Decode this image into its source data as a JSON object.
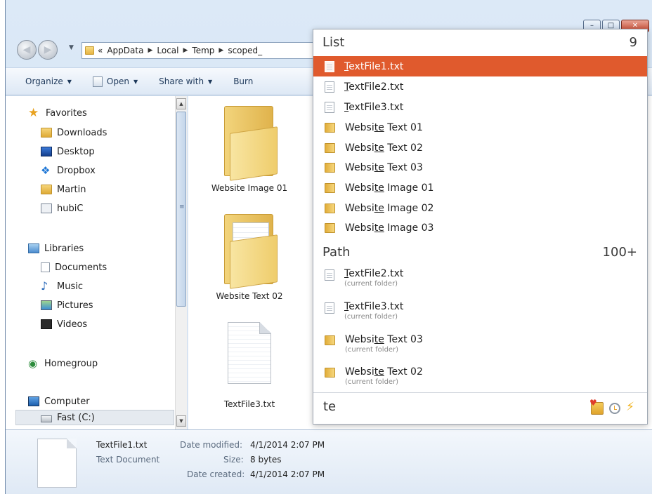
{
  "address": {
    "overflow": "«",
    "crumbs": [
      "AppData",
      "Local",
      "Temp",
      "scoped_"
    ]
  },
  "toolbar": {
    "organize": "Organize",
    "open": "Open",
    "share_with": "Share with",
    "burn": "Burn"
  },
  "nav": {
    "favorites": "Favorites",
    "downloads": "Downloads",
    "desktop": "Desktop",
    "dropbox": "Dropbox",
    "martin": "Martin",
    "hubic": "hubiC",
    "libraries": "Libraries",
    "documents": "Documents",
    "music": "Music",
    "pictures": "Pictures",
    "videos": "Videos",
    "homegroup": "Homegroup",
    "computer": "Computer",
    "drive": "Fast (C:)"
  },
  "content": {
    "tile1": "Website Image 01",
    "tile2": "Website Text 02",
    "tile3": "TextFile3.txt"
  },
  "details": {
    "name": "TextFile1.txt",
    "type": "Text Document",
    "modified_label": "Date modified:",
    "modified_value": "4/1/2014 2:07 PM",
    "size_label": "Size:",
    "size_value": "8 bytes",
    "created_label": "Date created:",
    "created_value": "4/1/2014 2:07 PM"
  },
  "overlay": {
    "list_header": "List",
    "list_count": "9",
    "list_items": [
      {
        "pre": "",
        "hl": "T",
        "post": "extFile1.txt"
      },
      {
        "pre": "",
        "hl": "T",
        "post": "extFile2.txt"
      },
      {
        "pre": "",
        "hl": "T",
        "post": "extFile3.txt"
      },
      {
        "pre": "Websi",
        "hl": "te",
        "post": " Text 01"
      },
      {
        "pre": "Websi",
        "hl": "te",
        "post": " Text 02"
      },
      {
        "pre": "Websi",
        "hl": "te",
        "post": " Text 03"
      },
      {
        "pre": "Websi",
        "hl": "te",
        "post": " Image 01"
      },
      {
        "pre": "Websi",
        "hl": "te",
        "post": " Image 02"
      },
      {
        "pre": "Websi",
        "hl": "te",
        "post": " Image 03"
      }
    ],
    "path_header": "Path",
    "path_count": "100+",
    "path_items": [
      {
        "pre": "",
        "hl": "T",
        "post": "extFile2.txt",
        "sub": "(current folder)"
      },
      {
        "pre": "",
        "hl": "T",
        "post": "extFile3.txt",
        "sub": "(current folder)"
      },
      {
        "pre": "Websi",
        "hl": "te",
        "post": " Text 03",
        "sub": "(current folder)"
      },
      {
        "pre": "Websi",
        "hl": "te",
        "post": " Text 02",
        "sub": "(current folder)"
      }
    ],
    "query": "te"
  },
  "icons": {
    "footer": [
      "folder-heart-icon",
      "history-icon",
      "lightning-icon"
    ]
  },
  "colors": {
    "selection": "#e05a2d"
  }
}
